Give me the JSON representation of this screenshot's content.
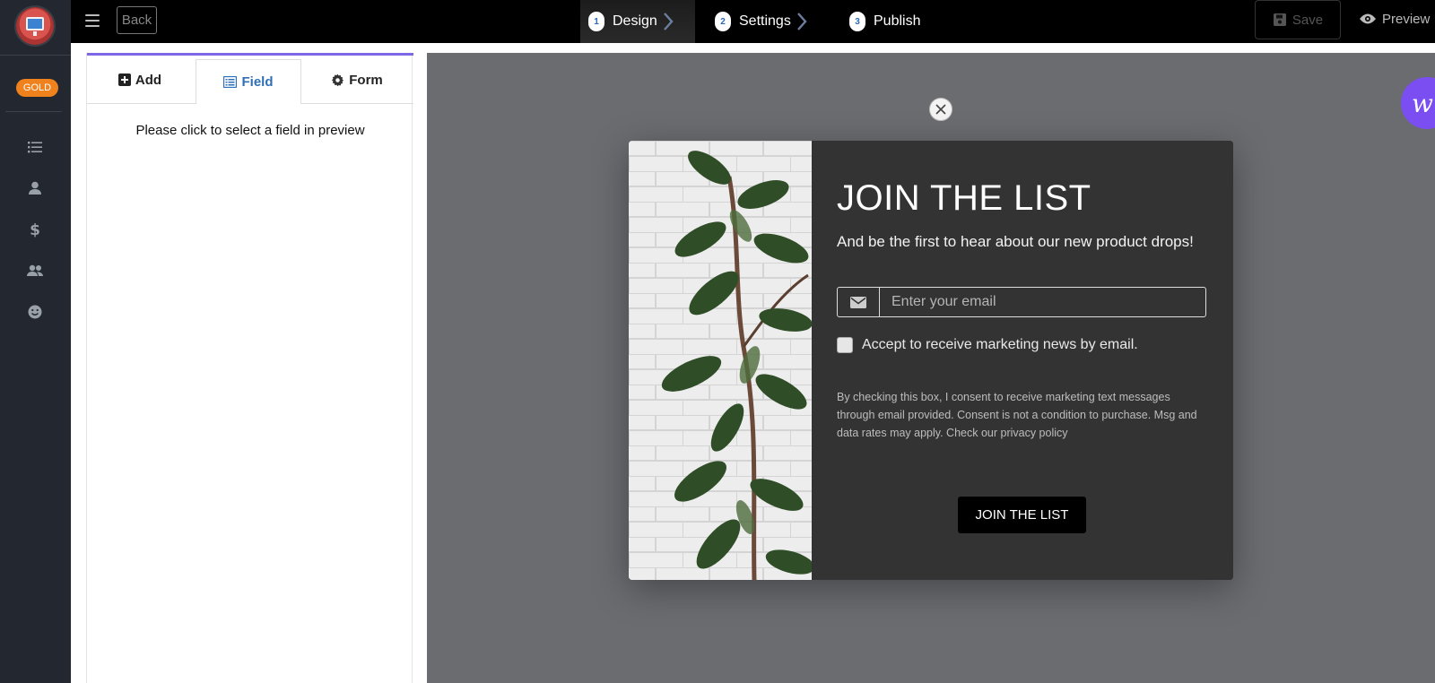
{
  "rail": {
    "badge": "GOLD",
    "icons": [
      "list-icon",
      "user-icon",
      "dollar-icon",
      "users-icon",
      "smile-icon"
    ]
  },
  "topbar": {
    "back_label": "Back",
    "steps": [
      {
        "num": "1",
        "label": "Design",
        "active": true
      },
      {
        "num": "2",
        "label": "Settings",
        "active": false
      },
      {
        "num": "3",
        "label": "Publish",
        "active": false
      }
    ],
    "save_label": "Save",
    "preview_label": "Preview"
  },
  "panel": {
    "tabs": [
      {
        "label": "Add",
        "icon": "plus-square-icon"
      },
      {
        "label": "Field",
        "icon": "list-alt-icon",
        "active": true
      },
      {
        "label": "Form",
        "icon": "gear-icon"
      }
    ],
    "hint": "Please click to select a field in preview"
  },
  "popup": {
    "title": "JOIN THE LIST",
    "subtitle": "And be the first to hear about our new product drops!",
    "email_placeholder": "Enter your email",
    "checkbox_label": "Accept to receive marketing news by email.",
    "consent_text": "By checking this box, I consent to receive marketing text messages through email provided. Consent is not a condition to purchase. Msg and data rates may apply. Check our privacy policy",
    "button_label": "JOIN THE LIST"
  },
  "colors": {
    "rail_bg": "#232830",
    "accent_tab": "#2f6fb5",
    "panel_topline": "#7d67e6",
    "popup_bg": "#333333",
    "badge": "#f0821e"
  }
}
